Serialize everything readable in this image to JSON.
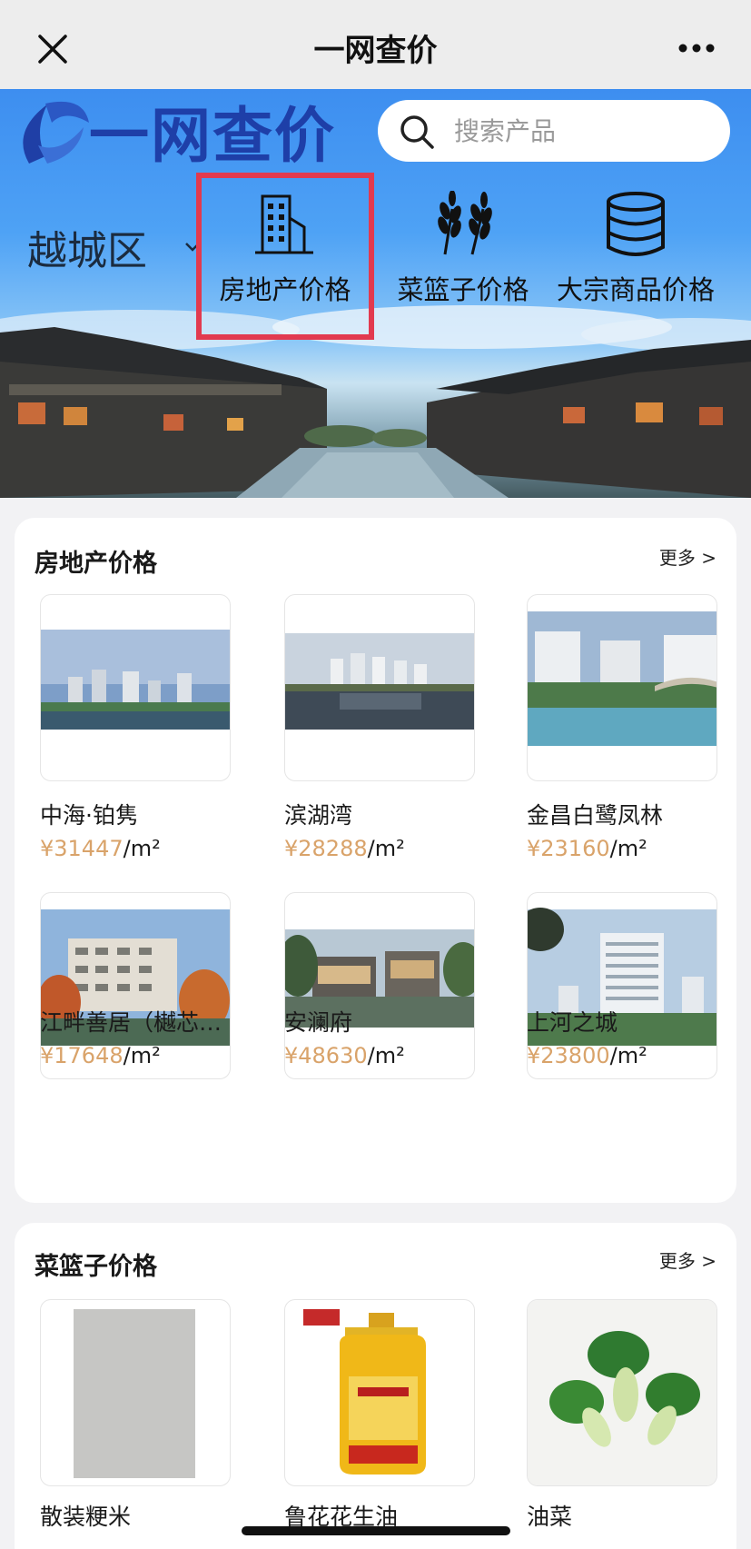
{
  "topbar": {
    "title": "一网查价"
  },
  "hero": {
    "logo_text": "一网查价",
    "search_placeholder": "搜索产品",
    "district": "越城区",
    "categories": [
      {
        "label": "房地产价格",
        "icon": "building-icon",
        "highlighted": true
      },
      {
        "label": "菜篮子价格",
        "icon": "wheat-icon",
        "highlighted": false
      },
      {
        "label": "大宗商品价格",
        "icon": "database-icon",
        "highlighted": false
      }
    ]
  },
  "real_estate": {
    "title": "房地产价格",
    "more_label": "更多 >",
    "items": [
      {
        "name": "中海·铂隽",
        "price": "¥31447",
        "unit": "/m²"
      },
      {
        "name": "滨湖湾",
        "price": "¥28288",
        "unit": "/m²"
      },
      {
        "name": "金昌白鹭凤林",
        "price": "¥23160",
        "unit": "/m²"
      },
      {
        "name": "江畔善居（樾芯…",
        "price": "¥17648",
        "unit": "/m²"
      },
      {
        "name": "安澜府",
        "price": "¥48630",
        "unit": "/m²"
      },
      {
        "name": "上河之城",
        "price": "¥23800",
        "unit": "/m²"
      }
    ]
  },
  "grocery": {
    "title": "菜篮子价格",
    "more_label": "更多 >",
    "items": [
      {
        "name": "散装粳米"
      },
      {
        "name": "鲁花花生油"
      },
      {
        "name": "油菜"
      }
    ]
  },
  "colors": {
    "price": "#d9a36a",
    "highlight": "#e23a4f",
    "logo": "#1e3fa8"
  }
}
